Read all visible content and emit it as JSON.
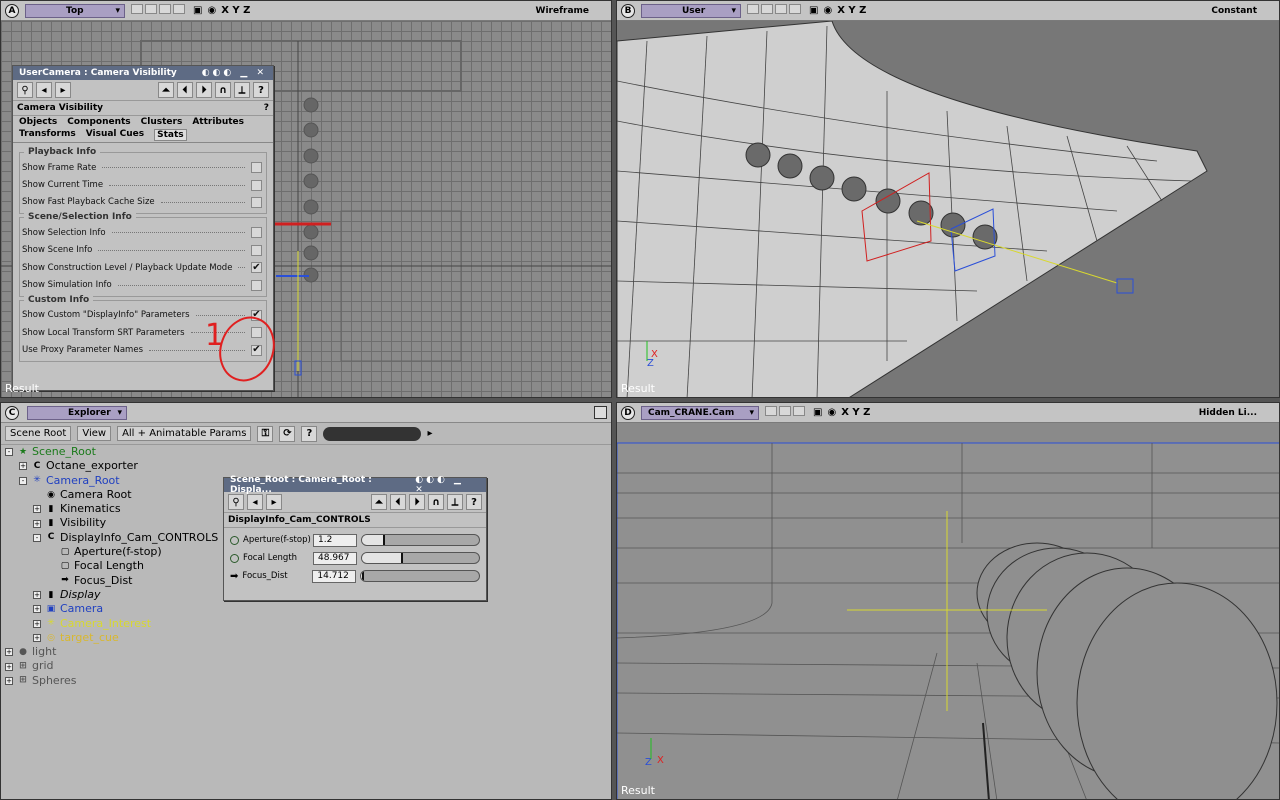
{
  "viewports": {
    "a": {
      "letter": "A",
      "view": "Top",
      "mode": "Wireframe",
      "axes": "X Y Z",
      "footer": "Result"
    },
    "b": {
      "letter": "B",
      "view": "User",
      "mode": "Constant",
      "axes": "X Y Z",
      "footer": "Result"
    },
    "c": {
      "letter": "C",
      "view": "Explorer"
    },
    "d": {
      "letter": "D",
      "view": "Cam_CRANE.Cam",
      "mode": "Hidden Li...",
      "axes": "X Y Z",
      "footer": "Result"
    }
  },
  "camvis": {
    "title": "UserCamera : Camera Visibility",
    "section": "Camera Visibility",
    "tabs_row1": [
      "Objects",
      "Components",
      "Clusters",
      "Attributes"
    ],
    "tabs_row2": [
      "Transforms",
      "Visual Cues",
      "Stats"
    ],
    "active_tab": "Stats",
    "groups": [
      {
        "title": "Playback Info",
        "rows": [
          {
            "label": "Show Frame Rate",
            "checked": false
          },
          {
            "label": "Show Current Time",
            "checked": false
          },
          {
            "label": "Show Fast Playback Cache Size",
            "checked": false
          }
        ]
      },
      {
        "title": "Scene/Selection Info",
        "rows": [
          {
            "label": "Show Selection Info",
            "checked": false
          },
          {
            "label": "Show Scene Info",
            "checked": false
          },
          {
            "label": "Show Construction Level / Playback Update Mode",
            "checked": true
          },
          {
            "label": "Show Simulation Info",
            "checked": false
          }
        ]
      },
      {
        "title": "Custom Info",
        "rows": [
          {
            "label": "Show Custom \"DisplayInfo\" Parameters",
            "checked": true
          },
          {
            "label": "Show Local Transform SRT Parameters",
            "checked": false
          },
          {
            "label": "Use Proxy Parameter Names",
            "checked": true
          }
        ]
      }
    ],
    "annotation": "1"
  },
  "explorer": {
    "scene_root_btn": "Scene Root",
    "view_btn": "View",
    "filter_btn": "All + Animatable Params",
    "tree": [
      {
        "label": "Scene_Root",
        "depth": 0,
        "color": "#1a7a1a",
        "icon": "★",
        "exp": "-"
      },
      {
        "label": "Octane_exporter",
        "depth": 1,
        "color": "#000",
        "icon": "C",
        "exp": "+"
      },
      {
        "label": "Camera_Root",
        "depth": 1,
        "color": "#2040c0",
        "icon": "✳",
        "exp": "-"
      },
      {
        "label": "Camera Root",
        "depth": 2,
        "color": "#000",
        "icon": "◉",
        "exp": ""
      },
      {
        "label": "Kinematics",
        "depth": 2,
        "color": "#000",
        "icon": "▮",
        "exp": "+"
      },
      {
        "label": "Visibility",
        "depth": 2,
        "color": "#000",
        "icon": "▮",
        "exp": "+"
      },
      {
        "label": "DisplayInfo_Cam_CONTROLS",
        "depth": 2,
        "color": "#000",
        "icon": "C",
        "exp": "-"
      },
      {
        "label": "Aperture(f-stop)",
        "depth": 3,
        "color": "#000",
        "icon": "▢",
        "exp": ""
      },
      {
        "label": "Focal Length",
        "depth": 3,
        "color": "#000",
        "icon": "▢",
        "exp": ""
      },
      {
        "label": "Focus_Dist",
        "depth": 3,
        "color": "#000",
        "icon": "➡",
        "exp": ""
      },
      {
        "label": "Display",
        "depth": 2,
        "color": "#000",
        "icon": "▮",
        "exp": "+",
        "italic": true
      },
      {
        "label": "Camera",
        "depth": 2,
        "color": "#2040c0",
        "icon": "▣",
        "exp": "+"
      },
      {
        "label": "Camera_Interest",
        "depth": 2,
        "color": "#d8d830",
        "icon": "✳",
        "exp": "+"
      },
      {
        "label": "target_cue",
        "depth": 2,
        "color": "#d8b830",
        "icon": "◎",
        "exp": "+"
      },
      {
        "label": "light",
        "depth": 0,
        "color": "#555",
        "icon": "●",
        "exp": "+"
      },
      {
        "label": "grid",
        "depth": 0,
        "color": "#555",
        "icon": "⊞",
        "exp": "+"
      },
      {
        "label": "Spheres",
        "depth": 0,
        "color": "#555",
        "icon": "⊞",
        "exp": "+"
      }
    ]
  },
  "dipanel": {
    "title": "Scene_Root : Camera_Root : Displa...",
    "section": "DisplayInfo_Cam_CONTROLS",
    "params": [
      {
        "label": "Aperture(f-stop)",
        "value": "1.2",
        "fraction": 0.2,
        "icon": "dot"
      },
      {
        "label": "Focal Length",
        "value": "48.967",
        "fraction": 0.35,
        "icon": "dot"
      },
      {
        "label": "Focus_Dist",
        "value": "14.712",
        "fraction": 0.02,
        "icon": "arrow"
      }
    ]
  }
}
